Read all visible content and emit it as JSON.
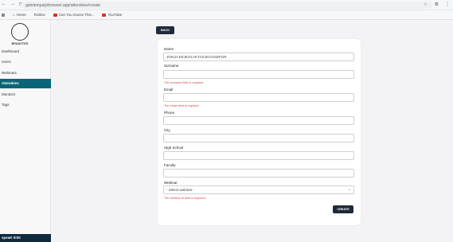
{
  "browser": {
    "url": "gaintempaijvbrowser.app/attendees/create",
    "bookmarks": [
      "Home",
      "Roblox",
      "Can You Guess This...",
      "YouTube"
    ]
  },
  "sidebar": {
    "logo_text": "BRANSTED",
    "items": [
      "Dashboard",
      "Users",
      "Webinars",
      "Attendees",
      "Monitors",
      "Tags"
    ],
    "bottom_text": "speaK 0!30"
  },
  "back_label": "BACK",
  "form": {
    "name_label": "Name",
    "name_value": "JOKLH.KEJKOLAKTCKJKOASDFGR",
    "surname_label": "Surname",
    "surname_error": "The surname field is required.",
    "email_label": "Email",
    "email_error": "The email field is required.",
    "phone_label": "Phone",
    "city_label": "City",
    "high_school_label": "High School",
    "faculty_label": "Faculty",
    "webinar_label": "Webinar",
    "webinar_placeholder": "- Select webinar -",
    "webinar_error": "The webinar id field is required.",
    "create_label": "CREATE"
  },
  "colors": {
    "accent": "#0c6577",
    "dark_button": "#1f2a3a",
    "error": "#d64545"
  }
}
